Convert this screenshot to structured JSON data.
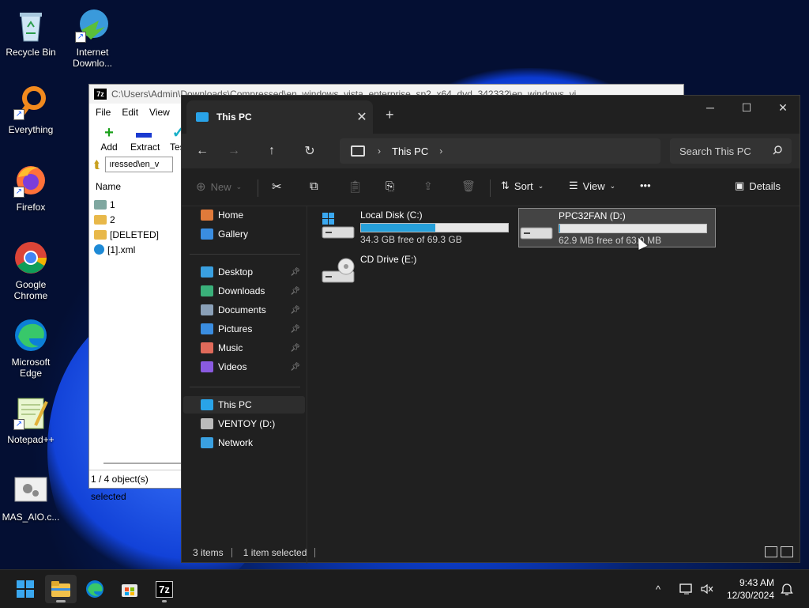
{
  "desktop": {
    "icons": [
      {
        "label": "Recycle Bin",
        "icon": "recycle-bin-icon"
      },
      {
        "label": "Internet Downlo...",
        "icon": "idm-icon"
      },
      {
        "label": "Everything",
        "icon": "everything-search-icon"
      },
      {
        "label": "Firefox",
        "icon": "firefox-icon"
      },
      {
        "label": "Google Chrome",
        "icon": "chrome-icon"
      },
      {
        "label": "Microsoft Edge",
        "icon": "edge-icon"
      },
      {
        "label": "Notepad++",
        "icon": "notepadpp-icon"
      },
      {
        "label": "MAS_AIO.c...",
        "icon": "script-file-icon"
      }
    ]
  },
  "zip_window": {
    "title": "C:\\Users\\Admin\\Downloads\\Compressed\\en_windows_vista_enterprise_sp2_x64_dvd_342332\\en_windows_vi",
    "menu": [
      "File",
      "Edit",
      "View"
    ],
    "toolbar": [
      {
        "label": "Add",
        "glyph": "+"
      },
      {
        "label": "Extract",
        "glyph": "▬"
      },
      {
        "label": "Test",
        "glyph": "✓"
      }
    ],
    "path_value": "ıressed\\en_v",
    "column_name": "Name",
    "rows": [
      {
        "name": "1",
        "color": "#7fa7a0"
      },
      {
        "name": "2",
        "color": "#e8b84a"
      },
      {
        "name": "[DELETED]",
        "color": "#e8b84a"
      },
      {
        "name": "[1].xml",
        "color": "#1e8ad6"
      }
    ],
    "status": "1 / 4 object(s) selected"
  },
  "explorer": {
    "tab_title": "This PC",
    "tab_close": "✕",
    "new_tab": "+",
    "controls": {
      "minimize": "─",
      "maximize": "☐",
      "close": "✕"
    },
    "nav": {
      "back": "←",
      "forward": "→",
      "up": "↑",
      "refresh": "↻"
    },
    "breadcrumb": [
      "This PC"
    ],
    "crumb_sep": "›",
    "search_placeholder": "Search This PC",
    "command_bar": {
      "new": "New",
      "sort": "Sort",
      "view": "View",
      "more": "•••",
      "details": "Details"
    },
    "sidebar": {
      "top": [
        {
          "label": "Home",
          "icon": "home-icon",
          "color": "#e07a3a"
        },
        {
          "label": "Gallery",
          "icon": "gallery-icon",
          "color": "#3a8de0"
        }
      ],
      "pinned": [
        {
          "label": "Desktop",
          "icon": "desktop-folder-icon",
          "color": "#3aa0e0"
        },
        {
          "label": "Downloads",
          "icon": "downloads-folder-icon",
          "color": "#3ab07a"
        },
        {
          "label": "Documents",
          "icon": "documents-folder-icon",
          "color": "#8aa0b8"
        },
        {
          "label": "Pictures",
          "icon": "pictures-folder-icon",
          "color": "#3a8de0"
        },
        {
          "label": "Music",
          "icon": "music-folder-icon",
          "color": "#e06a5a"
        },
        {
          "label": "Videos",
          "icon": "videos-folder-icon",
          "color": "#8a5ae0"
        }
      ],
      "bottom": [
        {
          "label": "This PC",
          "icon": "this-pc-icon",
          "color": "#29a3e8",
          "selected": true
        },
        {
          "label": "VENTOY (D:)",
          "icon": "drive-icon",
          "color": "#bbbbbb",
          "selected": false
        },
        {
          "label": "Network",
          "icon": "network-icon",
          "color": "#3aa0e0",
          "selected": false
        }
      ]
    },
    "drives": [
      {
        "name": "Local Disk (C:)",
        "free": "34.3 GB free of 69.3 GB",
        "used_fraction": 0.505,
        "has_bar": true,
        "selected": false,
        "icon": "system-drive-icon"
      },
      {
        "name": "PPC32FAN (D:)",
        "free": "62.9 MB free of 63.0 MB",
        "used_fraction": 0.002,
        "has_bar": true,
        "selected": true,
        "icon": "usb-drive-icon"
      },
      {
        "name": "CD Drive (E:)",
        "free": "",
        "used_fraction": 0,
        "has_bar": false,
        "selected": false,
        "icon": "cd-drive-icon"
      }
    ],
    "status": {
      "items": "3 items",
      "selected": "1 item selected"
    }
  },
  "taskbar": {
    "apps": [
      {
        "name": "start",
        "icon": "windows-start-icon"
      },
      {
        "name": "file-explorer",
        "icon": "file-explorer-icon",
        "active": true
      },
      {
        "name": "edge",
        "icon": "edge-icon"
      },
      {
        "name": "store",
        "icon": "store-icon"
      },
      {
        "name": "7zip",
        "icon": "7zip-icon",
        "label": "7z"
      }
    ],
    "tray": {
      "chevron": "^",
      "time": "9:43 AM",
      "date": "12/30/2024"
    }
  }
}
